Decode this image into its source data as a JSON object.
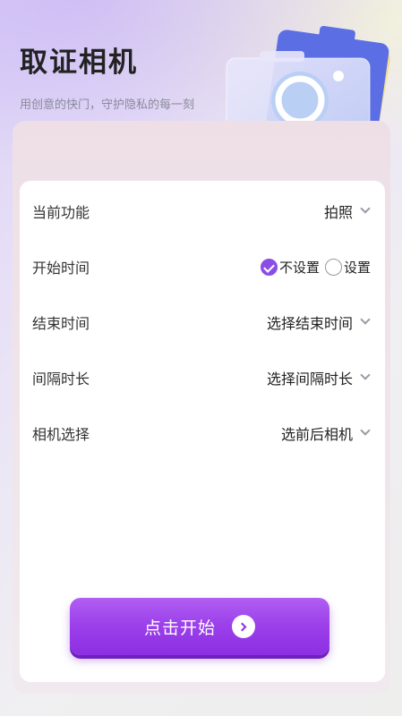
{
  "header": {
    "title": "取证相机",
    "subtitle": "用创意的快门，守护隐私的每一刻"
  },
  "settings": {
    "rows": [
      {
        "label": "当前功能",
        "value": "拍照"
      },
      {
        "label": "开始时间",
        "options": [
          "不设置",
          "设置"
        ],
        "selected": "不设置"
      },
      {
        "label": "结束时间",
        "value": "选择结束时间"
      },
      {
        "label": "间隔时长",
        "value": "选择间隔时长"
      },
      {
        "label": "相机选择",
        "value": "选前后相机"
      }
    ]
  },
  "action": {
    "start_label": "点击开始"
  },
  "colors": {
    "accent": "#8a4ee6",
    "button": "#9a3fea"
  },
  "icons": [
    "camera-icon",
    "chevron-down-icon",
    "check-icon",
    "arrow-right-icon"
  ]
}
